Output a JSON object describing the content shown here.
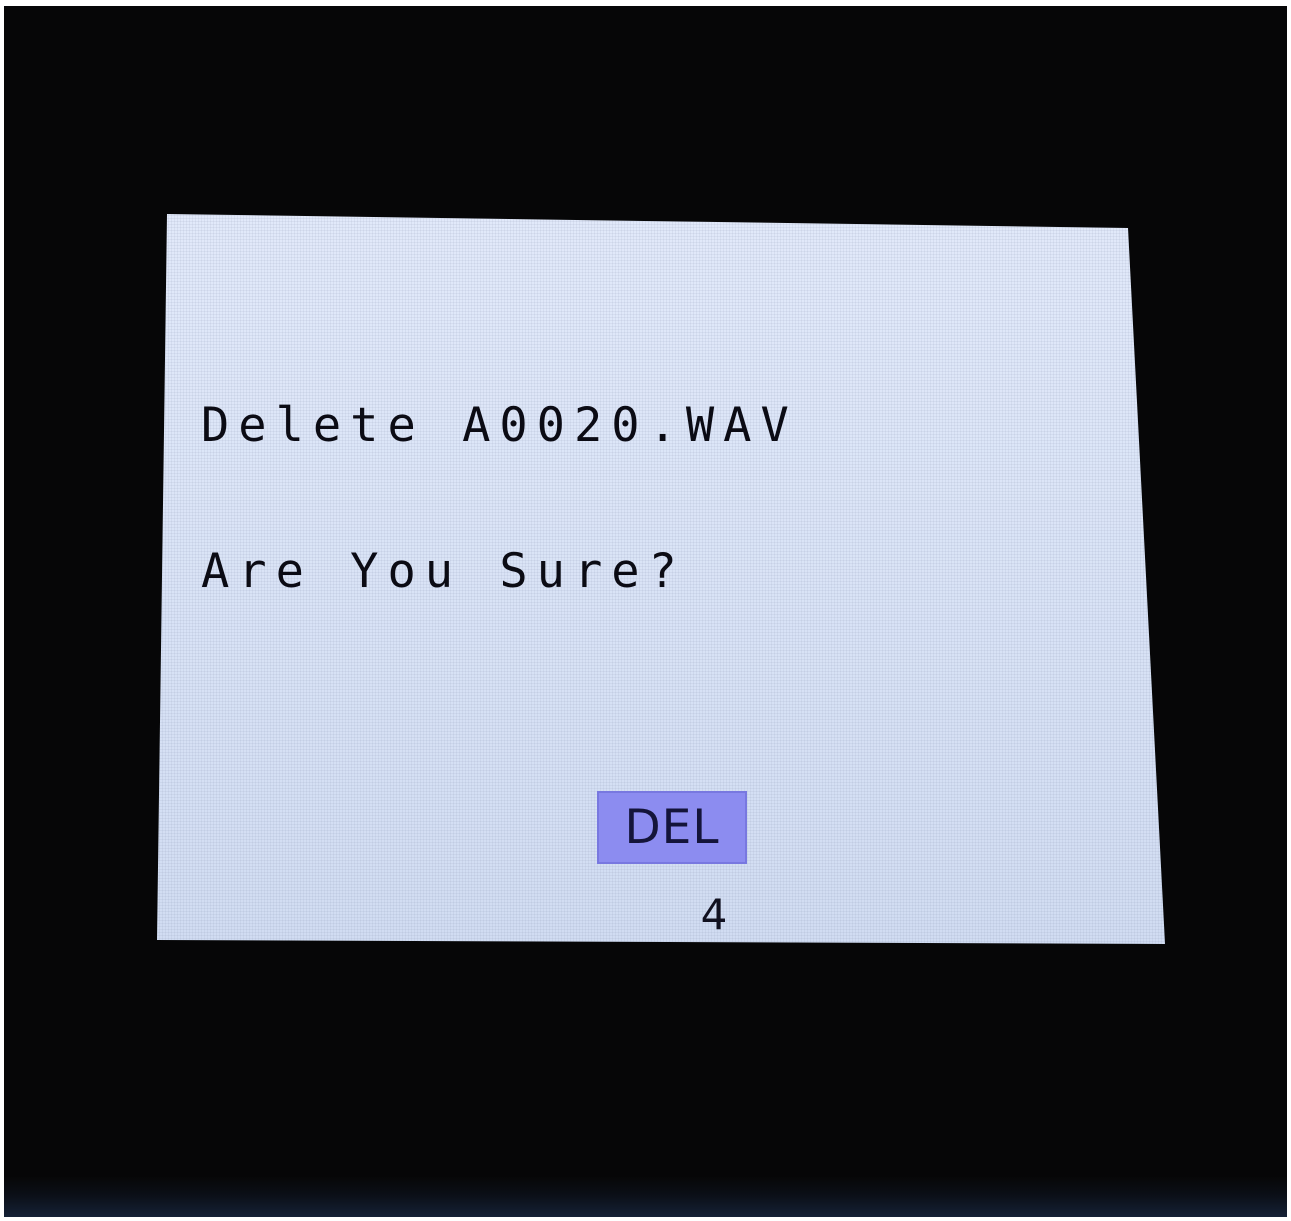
{
  "dialog": {
    "message_line_1": "Delete A0020.WAV",
    "message_line_2": "Are You Sure?"
  },
  "softkey": {
    "label": "DEL",
    "number": "4"
  },
  "colors": {
    "screen_background": "#dde6f8",
    "softkey_background": "#8c8cf0",
    "text": "#0b0b14",
    "bezel": "#060607"
  }
}
